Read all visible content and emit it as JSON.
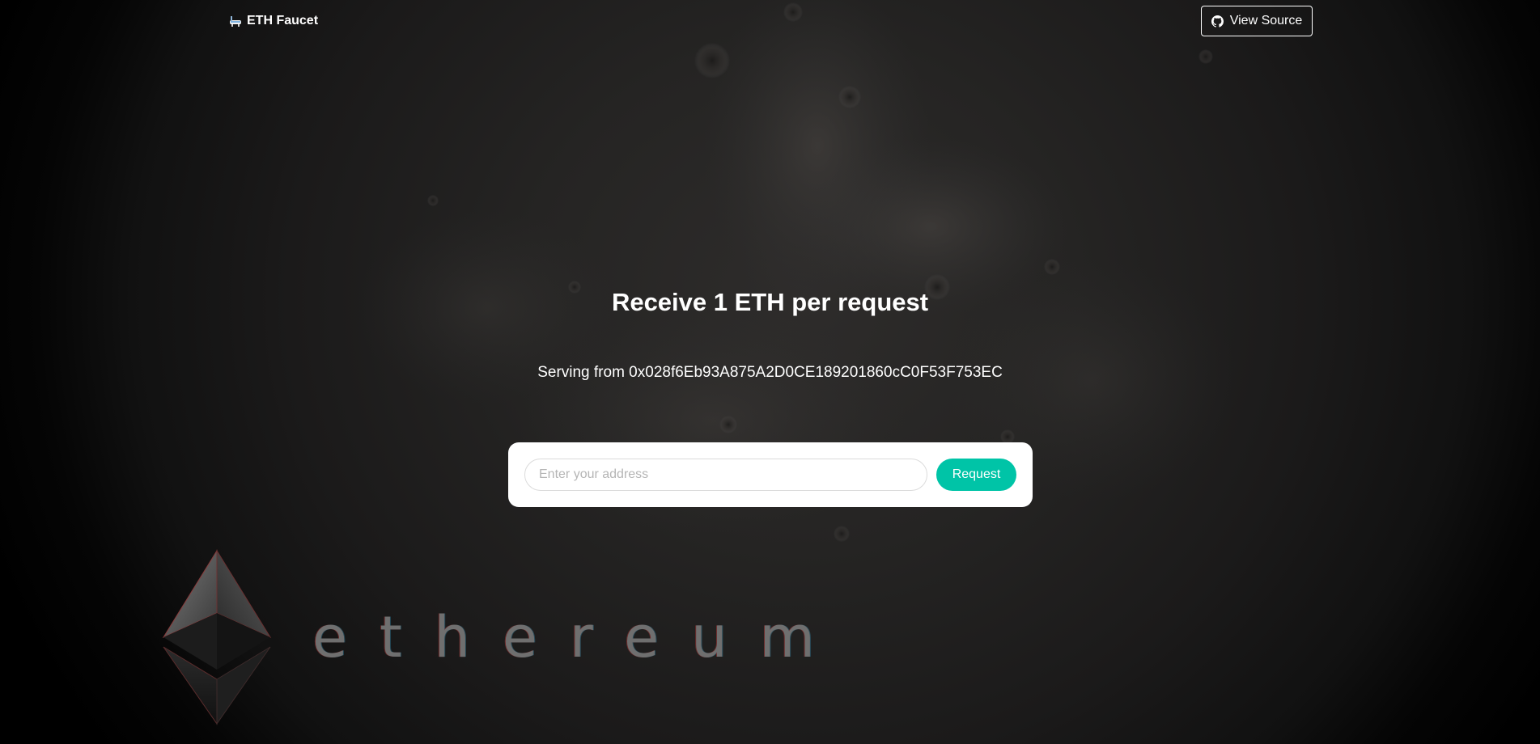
{
  "navbar": {
    "brand_icon": "bathtub-icon",
    "brand_label": "ETH Faucet",
    "view_source_icon": "github-icon",
    "view_source_label": "View Source"
  },
  "hero": {
    "headline": "Receive 1 ETH per request",
    "serving_text": "Serving from 0x028f6Eb93A875A2D0CE189201860cC0F53F753EC"
  },
  "request_form": {
    "address_placeholder": "Enter your address",
    "address_value": "",
    "request_label": "Request"
  },
  "background": {
    "logo_wordmark": "ethereum"
  },
  "colors": {
    "accent": "#00c4a7",
    "text": "#ffffff",
    "card": "#ffffff"
  }
}
